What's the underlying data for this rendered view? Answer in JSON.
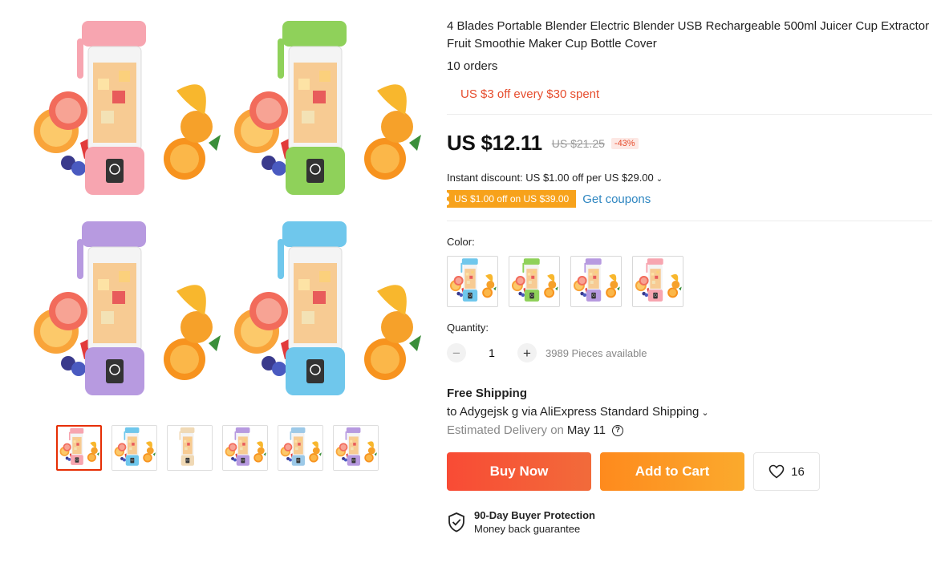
{
  "product": {
    "title": "4 Blades Portable Blender Electric Blender USB Rechargeable 500ml Juicer Cup Extractor Fruit Smoothie Maker Cup Bottle Cover",
    "orders": "10 orders",
    "promo": "US $3 off every $30 spent",
    "price": "US $12.11",
    "old_price": "US $21.25",
    "discount_pct": "-43%",
    "instant_discount": "Instant discount: US $1.00 off per US $29.00",
    "coupon_tag": "US $1.00 off on US $39.00",
    "get_coupons": "Get coupons"
  },
  "gallery": {
    "colors": [
      "#f7a5b0",
      "#8fd15a",
      "#b79ae0",
      "#6fc7ec"
    ],
    "thumbnails": [
      "main",
      "blue",
      "diagram",
      "colors",
      "kitchen",
      "purple"
    ],
    "active_index": 0
  },
  "color_option": {
    "label": "Color:",
    "swatches": [
      "#6fc7ec",
      "#8fd15a",
      "#b79ae0",
      "#f7a5b0"
    ]
  },
  "quantity": {
    "label": "Quantity:",
    "value": "1",
    "available": "3989 Pieces available"
  },
  "shipping": {
    "title": "Free Shipping",
    "to": "to Adygejsk g via AliExpress Standard Shipping",
    "estimated_label": "Estimated Delivery on",
    "date": "May 11"
  },
  "actions": {
    "buy_now": "Buy Now",
    "add_to_cart": "Add to Cart",
    "wishlist_count": "16"
  },
  "protection": {
    "title": "90-Day Buyer Protection",
    "subtitle": "Money back guarantee"
  }
}
